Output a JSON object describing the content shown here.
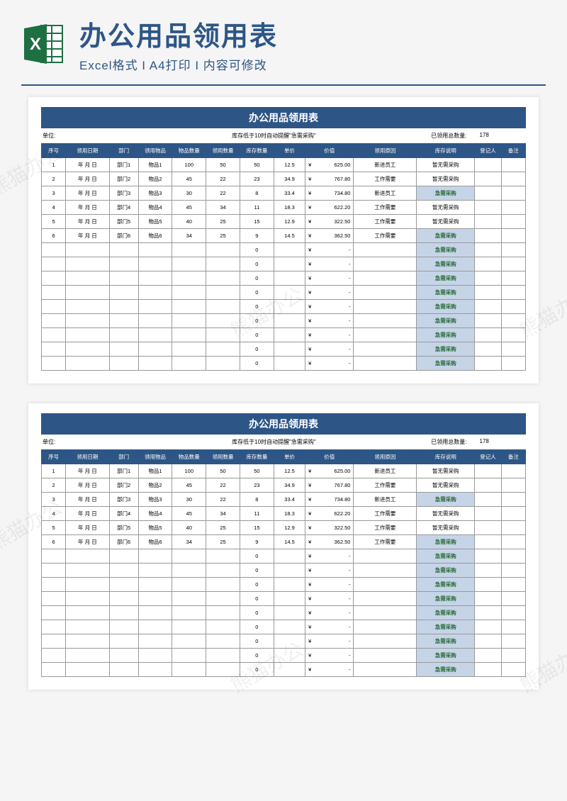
{
  "header": {
    "title": "办公用品领用表",
    "subtitle": "Excel格式 I A4打印 I 内容可修改"
  },
  "sheet": {
    "title": "办公用品领用表",
    "unit_label": "单位:",
    "reminder": "库存低于10时自动提醒\"急需采购\"",
    "total_label": "已领用总数量:",
    "total_value": "178",
    "headers": [
      "序号",
      "领用日期",
      "部门",
      "领用物品",
      "物品数量",
      "领用数量",
      "库存数量",
      "单价",
      "价值",
      "领用原因",
      "库存说明",
      "登记人",
      "备注"
    ],
    "rows": [
      {
        "idx": "1",
        "date": "年 月 日",
        "dept": "部门1",
        "item": "物品1",
        "qty": "100",
        "req": "50",
        "stock": "50",
        "unit": "12.5",
        "value": "625.00",
        "reason": "新进员工",
        "status": "暂无需采购",
        "alert": false
      },
      {
        "idx": "2",
        "date": "年 月 日",
        "dept": "部门2",
        "item": "物品2",
        "qty": "45",
        "req": "22",
        "stock": "23",
        "unit": "34.9",
        "value": "767.80",
        "reason": "工作需要",
        "status": "暂无需采购",
        "alert": false
      },
      {
        "idx": "3",
        "date": "年 月 日",
        "dept": "部门3",
        "item": "物品3",
        "qty": "30",
        "req": "22",
        "stock": "8",
        "unit": "33.4",
        "value": "734.80",
        "reason": "新进员工",
        "status": "急需采购",
        "alert": true
      },
      {
        "idx": "4",
        "date": "年 月 日",
        "dept": "部门4",
        "item": "物品4",
        "qty": "45",
        "req": "34",
        "stock": "11",
        "unit": "18.3",
        "value": "622.20",
        "reason": "工作需要",
        "status": "暂无需采购",
        "alert": false
      },
      {
        "idx": "5",
        "date": "年 月 日",
        "dept": "部门5",
        "item": "物品5",
        "qty": "40",
        "req": "25",
        "stock": "15",
        "unit": "12.9",
        "value": "322.50",
        "reason": "工作需要",
        "status": "暂无需采购",
        "alert": false
      },
      {
        "idx": "6",
        "date": "年 月 日",
        "dept": "部门6",
        "item": "物品6",
        "qty": "34",
        "req": "25",
        "stock": "9",
        "unit": "14.5",
        "value": "362.50",
        "reason": "工作需要",
        "status": "急需采购",
        "alert": true
      },
      {
        "idx": "",
        "date": "",
        "dept": "",
        "item": "",
        "qty": "",
        "req": "",
        "stock": "0",
        "unit": "",
        "value": "-",
        "reason": "",
        "status": "急需采购",
        "alert": true
      },
      {
        "idx": "",
        "date": "",
        "dept": "",
        "item": "",
        "qty": "",
        "req": "",
        "stock": "0",
        "unit": "",
        "value": "-",
        "reason": "",
        "status": "急需采购",
        "alert": true
      },
      {
        "idx": "",
        "date": "",
        "dept": "",
        "item": "",
        "qty": "",
        "req": "",
        "stock": "0",
        "unit": "",
        "value": "-",
        "reason": "",
        "status": "急需采购",
        "alert": true
      },
      {
        "idx": "",
        "date": "",
        "dept": "",
        "item": "",
        "qty": "",
        "req": "",
        "stock": "0",
        "unit": "",
        "value": "-",
        "reason": "",
        "status": "急需采购",
        "alert": true
      },
      {
        "idx": "",
        "date": "",
        "dept": "",
        "item": "",
        "qty": "",
        "req": "",
        "stock": "0",
        "unit": "",
        "value": "-",
        "reason": "",
        "status": "急需采购",
        "alert": true
      },
      {
        "idx": "",
        "date": "",
        "dept": "",
        "item": "",
        "qty": "",
        "req": "",
        "stock": "0",
        "unit": "",
        "value": "-",
        "reason": "",
        "status": "急需采购",
        "alert": true
      },
      {
        "idx": "",
        "date": "",
        "dept": "",
        "item": "",
        "qty": "",
        "req": "",
        "stock": "0",
        "unit": "",
        "value": "-",
        "reason": "",
        "status": "急需采购",
        "alert": true
      },
      {
        "idx": "",
        "date": "",
        "dept": "",
        "item": "",
        "qty": "",
        "req": "",
        "stock": "0",
        "unit": "",
        "value": "-",
        "reason": "",
        "status": "急需采购",
        "alert": true
      },
      {
        "idx": "",
        "date": "",
        "dept": "",
        "item": "",
        "qty": "",
        "req": "",
        "stock": "0",
        "unit": "",
        "value": "-",
        "reason": "",
        "status": "急需采购",
        "alert": true
      }
    ],
    "currency": "¥"
  },
  "watermark": "熊猫办公"
}
